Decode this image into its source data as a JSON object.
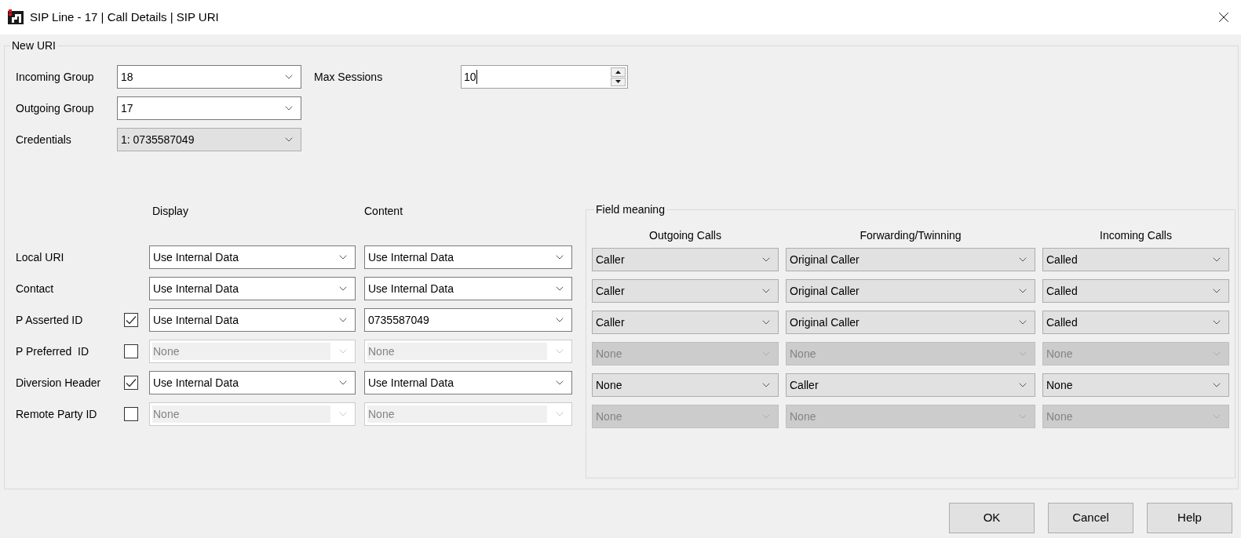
{
  "window": {
    "title": "SIP Line - 17 | Call Details | SIP URI"
  },
  "group": {
    "title": "New URI"
  },
  "fields": [
    {
      "label": "Incoming Group",
      "value": "18",
      "editable": true
    },
    {
      "label": "Outgoing Group",
      "value": "17",
      "editable": true
    },
    {
      "label": "Credentials",
      "value": "1: 0735587049",
      "editable": false
    }
  ],
  "max_sessions": {
    "label": "Max Sessions",
    "value": "10",
    "focused": true
  },
  "mapping_columns": [
    "Display",
    "Content"
  ],
  "rows": [
    {
      "kind": "plain",
      "label": "Local URI",
      "display": {
        "value": "Use Internal Data",
        "disabled": false
      },
      "content": {
        "value": "Use Internal Data",
        "disabled": false
      }
    },
    {
      "kind": "plain",
      "label": "Contact",
      "display": {
        "value": "Use Internal Data",
        "disabled": false
      },
      "content": {
        "value": "Use Internal Data",
        "disabled": false
      }
    },
    {
      "kind": "checkbox",
      "label": "P Asserted ID",
      "checked": true,
      "display": {
        "value": "Use Internal Data",
        "disabled": false
      },
      "content": {
        "value": "0735587049",
        "disabled": false
      }
    },
    {
      "kind": "checkbox",
      "label": "P Preferred  ID",
      "checked": false,
      "display": {
        "value": "None",
        "disabled": true
      },
      "content": {
        "value": "None",
        "disabled": true
      }
    },
    {
      "kind": "checkbox",
      "label": "Diversion Header",
      "checked": true,
      "display": {
        "value": "Use Internal Data",
        "disabled": false
      },
      "content": {
        "value": "Use Internal Data",
        "disabled": false
      }
    },
    {
      "kind": "checkbox",
      "label": "Remote Party ID",
      "checked": false,
      "display": {
        "value": "None",
        "disabled": true
      },
      "content": {
        "value": "None",
        "disabled": true
      }
    }
  ],
  "field_meaning": {
    "title": "Field meaning",
    "columns": [
      "Outgoing Calls",
      "Forwarding/Twinning",
      "Incoming Calls"
    ],
    "rows": [
      {
        "cells": [
          {
            "value": "Caller",
            "disabled": false
          },
          {
            "value": "Original Caller",
            "disabled": false
          },
          {
            "value": "Called",
            "disabled": false
          }
        ]
      },
      {
        "cells": [
          {
            "value": "Caller",
            "disabled": false
          },
          {
            "value": "Original Caller",
            "disabled": false
          },
          {
            "value": "Called",
            "disabled": false
          }
        ]
      },
      {
        "cells": [
          {
            "value": "Caller",
            "disabled": false
          },
          {
            "value": "Original Caller",
            "disabled": false
          },
          {
            "value": "Called",
            "disabled": false
          }
        ]
      },
      {
        "cells": [
          {
            "value": "None",
            "disabled": true
          },
          {
            "value": "None",
            "disabled": true
          },
          {
            "value": "None",
            "disabled": true
          }
        ]
      },
      {
        "cells": [
          {
            "value": "None",
            "disabled": false
          },
          {
            "value": "Caller",
            "disabled": false
          },
          {
            "value": "None",
            "disabled": false
          }
        ]
      },
      {
        "cells": [
          {
            "value": "None",
            "disabled": true
          },
          {
            "value": "None",
            "disabled": true
          },
          {
            "value": "None",
            "disabled": true
          }
        ]
      }
    ]
  },
  "buttons": [
    "OK",
    "Cancel",
    "Help"
  ]
}
